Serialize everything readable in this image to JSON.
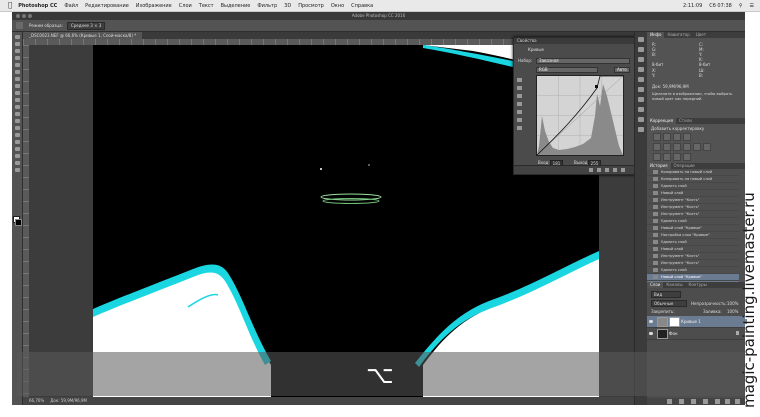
{
  "menubar": {
    "app": "Photoshop CC",
    "items": [
      "Файл",
      "Редактирование",
      "Изображение",
      "Слои",
      "Текст",
      "Выделение",
      "Фильтр",
      "3D",
      "Просмотр",
      "Окно",
      "Справка"
    ],
    "status": [
      "2:11:09",
      "Сб 07:38"
    ]
  },
  "window": {
    "title": "Adobe Photoshop CC 2016"
  },
  "options": {
    "mode_label": "Режим образца:",
    "mode_value": "Среднее 3 × 3"
  },
  "document": {
    "tab": "_DSC0023.NEF @ 66,6% (Кривые 1, Слой-маска/8) *",
    "zoom": "66,76%",
    "doc_size": "Док: 59,9M/96,9M"
  },
  "curves": {
    "panel_title": "Свойства",
    "header": "Кривые",
    "preset_label": "Набор:",
    "preset_value": "Заказная",
    "channel_value": "RGB",
    "auto_label": "Авто",
    "input_label": "Вход:",
    "input_value": "181",
    "output_label": "Выход:",
    "output_value": "255"
  },
  "info_panel": {
    "tabs": [
      "Инфо",
      "Навигатор",
      "Цвет"
    ],
    "r_label": "R:",
    "g_label": "G:",
    "b_label": "B:",
    "c_label": "C:",
    "m_label": "M:",
    "y_label": "Y:",
    "k_label": "K:",
    "x_label": "X:",
    "y2_label": "Y:",
    "w_label": "Ш:",
    "h_label": "В:",
    "bit_left": "8-бит",
    "bit_right": "8-бит",
    "doc": "Док: 59,9M/96,9M",
    "hint": "Щелкните в изображении, чтобы выбрать новый цвет как передний."
  },
  "adjustments": {
    "tabs": [
      "Коррекция",
      "Стили"
    ],
    "title": "Добавить корректировку"
  },
  "history": {
    "tabs": [
      "История",
      "Операции"
    ],
    "items": [
      "Копировать на новый слой",
      "Копировать на новый слой",
      "Удалить слой",
      "Новый слой",
      "Инструмент \"Кисть\"",
      "Инструмент \"Кисть\"",
      "Инструмент \"Кисть\"",
      "Удалить слой",
      "Новый слой \"Кривые\"",
      "Настройка слоя \"Кривые\"",
      "Удалить слой",
      "Новый слой",
      "Инструмент \"Кисть\"",
      "Инструмент \"Кисть\"",
      "Удалить слой",
      "Новый слой \"Кривые\"",
      "Настройка слоя \"Кривые\""
    ]
  },
  "layers": {
    "tabs": [
      "Слои",
      "Каналы",
      "Контуры"
    ],
    "kind": "Вид",
    "blend": "Обычные",
    "opacity_label": "Непрозрачность:",
    "opacity_value": "100%",
    "lock_label": "Закрепить:",
    "fill_label": "Заливка:",
    "fill_value": "100%",
    "rows": [
      {
        "name": "Кривые 1"
      },
      {
        "name": "Фон"
      }
    ]
  },
  "overlay": {
    "key": "⌥"
  },
  "watermark": "magic-painting.livemaster.ru"
}
